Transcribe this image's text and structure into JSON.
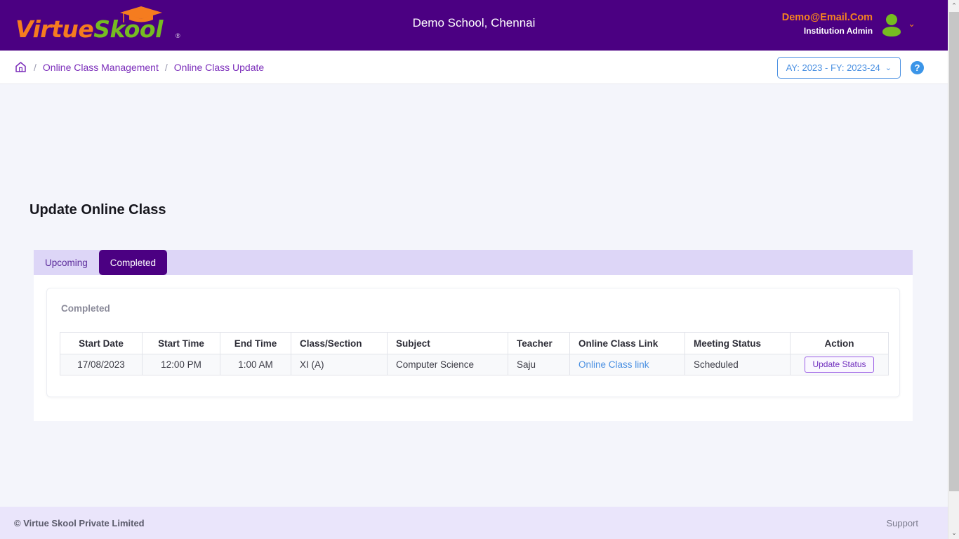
{
  "header": {
    "logo": {
      "part1": "Virtue",
      "part2": "Skool",
      "trademark": "®",
      "icon": "graduation-cap-icon",
      "color1": "#f57c1f",
      "color2": "#76bc21"
    },
    "school_name": "Demo School, Chennai",
    "user": {
      "email": "Demo@Email.Com",
      "role": "Institution Admin",
      "caret": "⌄"
    },
    "background": "#4b0082"
  },
  "breadcrumb": {
    "home_icon": "home-icon",
    "separator": "/",
    "items": [
      {
        "label": "Online Class Management"
      },
      {
        "label": "Online Class Update"
      }
    ],
    "link_color": "#7b2dba"
  },
  "toolbar": {
    "academic_year": "AY: 2023 - FY: 2023-24",
    "academic_year_caret": "⌄",
    "help_label": "?",
    "accent_blue": "#4a90e2"
  },
  "main": {
    "page_title": "Update Online Class",
    "tabs": [
      {
        "label": "Upcoming",
        "active": false
      },
      {
        "label": "Completed",
        "active": true
      }
    ],
    "section_label": "Completed",
    "table": {
      "columns": [
        {
          "label": "Start Date",
          "align": "center"
        },
        {
          "label": "Start Time",
          "align": "center"
        },
        {
          "label": "End Time",
          "align": "center"
        },
        {
          "label": "Class/Section",
          "align": "left"
        },
        {
          "label": "Subject",
          "align": "left"
        },
        {
          "label": "Teacher",
          "align": "left"
        },
        {
          "label": "Online Class Link",
          "align": "left"
        },
        {
          "label": "Meeting Status",
          "align": "left"
        },
        {
          "label": "Action",
          "align": "center"
        }
      ],
      "rows": [
        {
          "start_date": "17/08/2023",
          "start_time": "12:00 PM",
          "end_time": "1:00 AM",
          "class_section": "XI (A)",
          "subject": "Computer Science",
          "teacher": "Saju",
          "online_class_link": "Online Class link",
          "meeting_status": "Scheduled",
          "action_label": "Update Status"
        }
      ]
    }
  },
  "footer": {
    "copyright": "© Virtue Skool Private Limited",
    "support": "Support"
  },
  "scrollbar": {
    "up_arrow": "⌃",
    "down_arrow": "⌄"
  }
}
